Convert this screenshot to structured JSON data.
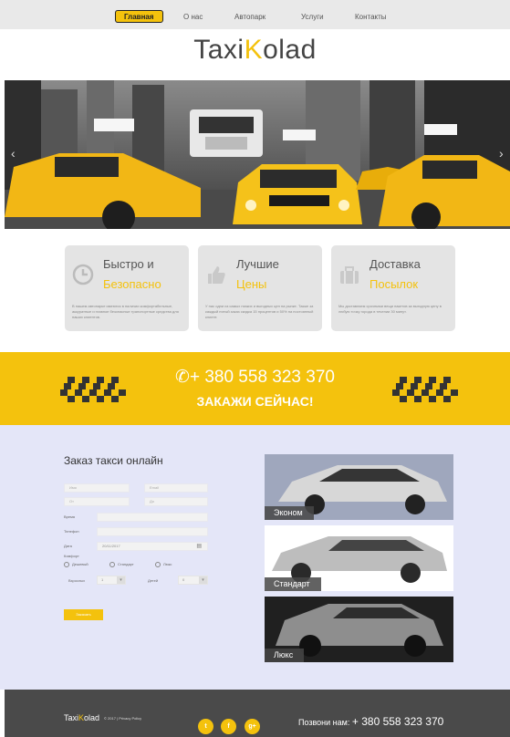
{
  "nav": {
    "items": [
      "Главная",
      "О нас",
      "Автопарк",
      "Услуги",
      "Контакты"
    ]
  },
  "logo": {
    "part1": "Taxi",
    "part2": "K",
    "part3": "olad"
  },
  "hero": {
    "prev_icon": "chevron-left",
    "next_icon": "chevron-right"
  },
  "features": [
    {
      "title1": "Быстро и",
      "title2": "Безопасно",
      "icon": "clock-icon",
      "desc": "В нашем автопарке имеются в наличии комфортабельные, аккуратные и главное безопасные транспортные средства для наших клиентов."
    },
    {
      "title1": "Лучшие",
      "title2": "Цены",
      "icon": "thumbs-up-icon",
      "desc": "У нас одни из самых низких и выгодных цен на рынке. Также за каждый пятый заказ скидка 15 процентов и 50% на постоянный клиент."
    },
    {
      "title1": "Доставка",
      "title2": "Посылок",
      "icon": "suitcase-icon",
      "desc": "Мы доставляем срочными вещи пакетов за выгодную цену в любую точку города в течении 30 минут."
    }
  ],
  "cta": {
    "phone": "+ 380 558 323 370",
    "order": "ЗАКАЖИ СЕЙЧАС!"
  },
  "form": {
    "title": "Заказ такси онлайн",
    "name_ph": "Имя",
    "email_ph": "Email",
    "from_ph": "От",
    "to_ph": "До",
    "time_label": "Время",
    "phone_label": "Телефон",
    "date_label": "Дата",
    "date_value": "20/11/2017",
    "comfort_label": "Комфорт",
    "comfort_options": [
      "Дешевый",
      "Стандарт",
      "Люкс"
    ],
    "adults_label": "Взрослых",
    "adults_value": "1",
    "kids_label": "Детей",
    "kids_value": "0",
    "submit": "Заказать"
  },
  "cars": [
    {
      "label": "Эконом"
    },
    {
      "label": "Стандарт"
    },
    {
      "label": "Люкс"
    }
  ],
  "footer": {
    "logo1": "Taxi",
    "logo2": "K",
    "logo3": "olad",
    "copyright": "© 2017 | Privacy Policy",
    "social": [
      "t",
      "f",
      "g+"
    ],
    "call_label": "Позвони нам:",
    "call_phone": "+ 380 558 323 370"
  },
  "colors": {
    "accent": "#f4c20d",
    "footer": "#4a4a4a",
    "order_bg": "#e4e6f8"
  }
}
